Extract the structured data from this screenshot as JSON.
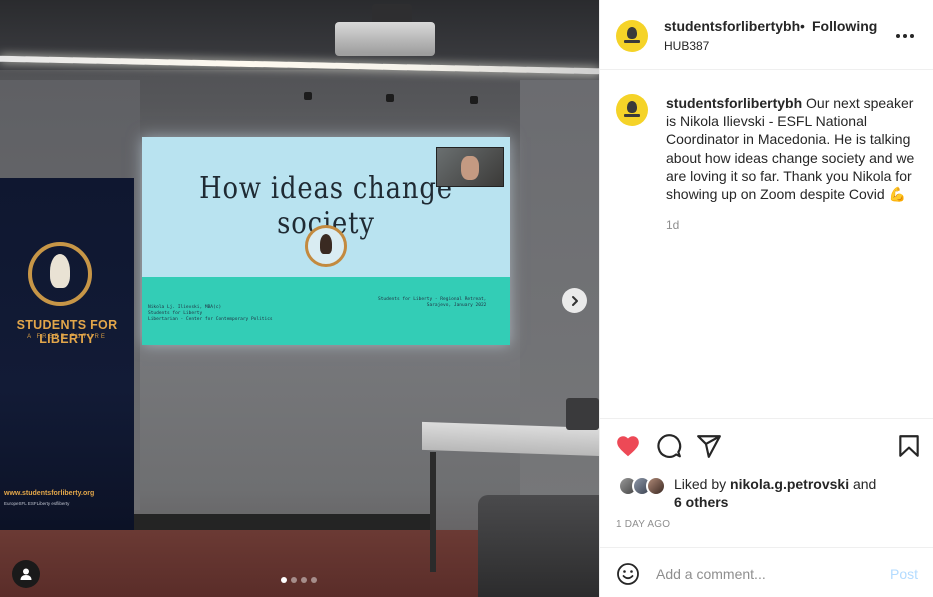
{
  "post": {
    "username": "studentsforlibertybh",
    "separator": "•",
    "follow_state": "Following",
    "location": "HUB387",
    "caption": "Our next speaker is Nikola Ilievski - ESFL National Coordinator in Macedonia. He is talking about how ideas change society and we are loving it so far. Thank you Nikola for showing up on Zoom despite Covid 💪",
    "time_relative": "1d",
    "liked_by_prefix": "Liked by",
    "liked_by_user": "nikola.g.petrovski",
    "liked_by_and": "and",
    "liked_by_others": "6 others",
    "date_ago": "1 DAY AGO"
  },
  "comment_bar": {
    "placeholder": "Add a comment...",
    "post_label": "Post"
  },
  "media": {
    "slide_title": "How ideas change society",
    "slide_left_text": "Nikola Lj. Ilievski, MBA(c)\nStudents for Liberty\nLibertarian - Center for Contemporary Politics",
    "slide_right_text": "Students for Liberty - Regional Retreat,\nSarajevo, January 2022",
    "banner_title": "STUDENTS FOR LIBERTY",
    "banner_sub": "A FREER FUTURE",
    "banner_url": "www.studentsforliberty.org",
    "banner_social": "EuropeSFL  ESFLiberty  esfliberty",
    "carousel_count": 4,
    "carousel_active": 0
  },
  "icons": [
    "more-options-icon",
    "heart-icon",
    "comment-icon",
    "share-icon",
    "bookmark-icon",
    "emoji-icon",
    "chevron-right-icon",
    "user-tag-icon"
  ],
  "colors": {
    "like_red": "#ed4956",
    "text": "#262626",
    "muted": "#8e8e8e",
    "post_disabled": "#b3dbff",
    "avatar_yellow": "#f5d328"
  }
}
